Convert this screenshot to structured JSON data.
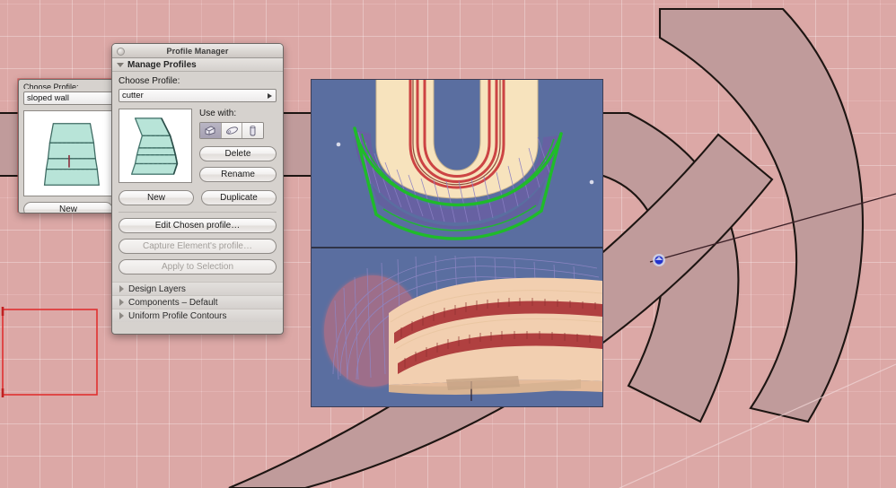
{
  "app": {
    "canvas_bg_color": "#dca8a6",
    "grid_color": "#d07878",
    "wall_fill_color": "#c09b9b",
    "wall_outline_color": "#1d1512",
    "selection_rect_color": "#e03030",
    "selection_handle_color": "#2233cc"
  },
  "profile_manager": {
    "title": "Profile Manager",
    "close_icon": "close-icon",
    "section": {
      "disclosure_icon": "chevron-down-icon",
      "title": "Manage Profiles"
    },
    "choose_profile_label": "Choose Profile:",
    "profile_combo": {
      "value": "cutter",
      "arrow_icon": "chevron-right-icon"
    },
    "preview": {
      "name": "profile-preview",
      "fill_color": "#b8e4d8",
      "stroke_color": "#3d6a62"
    },
    "use_with": {
      "label": "Use with:",
      "options": [
        {
          "icon": "wall-icon",
          "selected": true
        },
        {
          "icon": "extrusion-icon",
          "selected": false
        },
        {
          "icon": "column-icon",
          "selected": false
        }
      ]
    },
    "buttons": {
      "delete": "Delete",
      "rename": "Rename",
      "new": "New",
      "duplicate": "Duplicate",
      "edit_chosen_profile": "Edit Chosen profile…",
      "capture_element_profile": "Capture Element's profile…",
      "apply_to_selection": "Apply to Selection"
    },
    "sections": [
      {
        "label": "Design Layers",
        "icon": "chevron-right-icon"
      },
      {
        "label": "Components – Default",
        "icon": "chevron-right-icon"
      },
      {
        "label": "Uniform Profile Contours",
        "icon": "chevron-right-icon"
      }
    ]
  },
  "background_window": {
    "choose_profile_label": "Choose Profile:",
    "profile_combo": {
      "value": "sloped wall"
    },
    "new_button": "New",
    "preview": {
      "fill_color": "#b8e4d8",
      "stroke_color": "#3d6a62"
    }
  },
  "viewports": {
    "background_color": "#5a6ea0",
    "top": {
      "name": "top-plan-viewport",
      "wall_fill": "#f6e0b8",
      "band_color": "#cc4444",
      "selection_color": "#1fbb2a",
      "mesh_color": "#6d5fa8"
    },
    "bottom": {
      "name": "perspective-viewport",
      "wall_fill": "#f2cfb0",
      "band_color": "#b04040",
      "wireframe_color": "#8e86c4",
      "glow_color": "#f07070"
    }
  }
}
